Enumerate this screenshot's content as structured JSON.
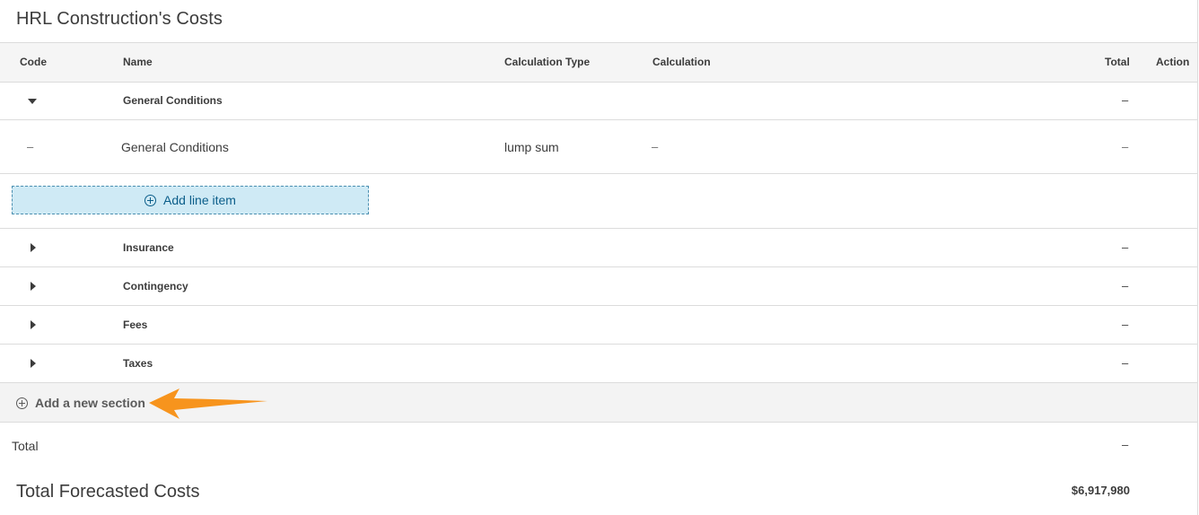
{
  "title": "HRL Construction's Costs",
  "columns": {
    "code": "Code",
    "name": "Name",
    "calc_type": "Calculation Type",
    "calculation": "Calculation",
    "total": "Total",
    "action": "Action"
  },
  "sections": [
    {
      "name": "General Conditions",
      "total": "–",
      "expanded": true
    },
    {
      "name": "Insurance",
      "total": "–",
      "expanded": false
    },
    {
      "name": "Contingency",
      "total": "–",
      "expanded": false
    },
    {
      "name": "Fees",
      "total": "–",
      "expanded": false
    },
    {
      "name": "Taxes",
      "total": "–",
      "expanded": false
    }
  ],
  "line_item": {
    "code": "–",
    "name": "General Conditions",
    "calc_type": "lump sum",
    "calculation": "–",
    "total": "–"
  },
  "add_line_item_label": "Add line item",
  "add_section_label": "Add a new section",
  "total_row": {
    "label": "Total",
    "value": "–"
  },
  "forecast": {
    "label": "Total Forecasted Costs",
    "value": "$6,917,980"
  },
  "colors": {
    "accent_button_bg": "#cfeaf5",
    "accent_button_text": "#0b5e8a",
    "annotation_arrow": "#f7941d"
  }
}
